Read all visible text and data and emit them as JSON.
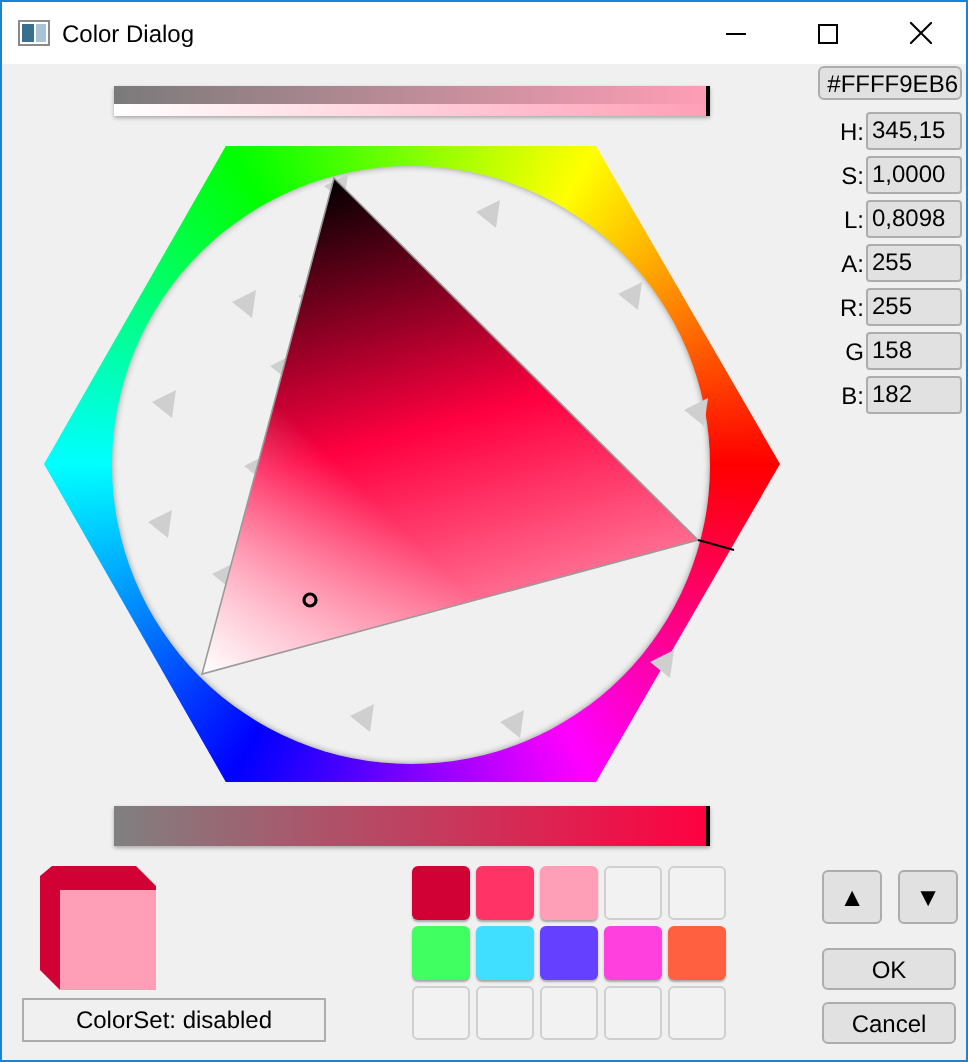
{
  "window": {
    "title": "Color Dialog"
  },
  "hex_value": "#FFFF9EB6",
  "alpha_bar": {
    "level": 1
  },
  "fields": [
    {
      "label": "H:",
      "value": "345,15"
    },
    {
      "label": "S:",
      "value": "1,0000"
    },
    {
      "label": "L:",
      "value": "0,8098"
    },
    {
      "label": "A:",
      "value": "255"
    },
    {
      "label": "R:",
      "value": "255"
    },
    {
      "label": "G",
      "value": "158"
    },
    {
      "label": "B:",
      "value": "182"
    }
  ],
  "saturation_bar": {
    "level": 1
  },
  "preview": [
    {
      "kind": "previous",
      "color": "#d10035"
    },
    {
      "kind": "current",
      "color": "#ff9eb6"
    }
  ],
  "colorset_status": "ColorSet: disabled",
  "swatches": [
    {
      "kind": "filled",
      "color": "#d10035"
    },
    {
      "kind": "filled",
      "color": "#ff3366"
    },
    {
      "kind": "filled",
      "color": "#ff9eb6"
    },
    {
      "kind": "empty"
    },
    {
      "kind": "empty"
    },
    {
      "kind": "filled",
      "color": "#40ff60"
    },
    {
      "kind": "filled",
      "color": "#40dfff"
    },
    {
      "kind": "filled",
      "color": "#6640ff"
    },
    {
      "kind": "filled",
      "color": "#ff40df"
    },
    {
      "kind": "filled",
      "color": "#ff6040"
    },
    {
      "kind": "empty"
    },
    {
      "kind": "empty"
    },
    {
      "kind": "empty"
    },
    {
      "kind": "empty"
    },
    {
      "kind": "empty"
    }
  ],
  "arrow_buttons": [
    "▲",
    "▼"
  ],
  "buttons": [
    "OK",
    "Cancel"
  ]
}
